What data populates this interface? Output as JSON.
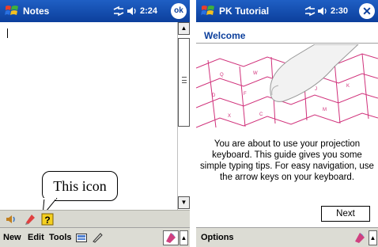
{
  "left": {
    "title": "Notes",
    "time": "2:24",
    "ok_label": "ok",
    "callout": "This icon",
    "menu": [
      "New",
      "Edit",
      "Tools"
    ]
  },
  "right": {
    "title": "PK Tutorial",
    "time": "2:30",
    "heading": "Welcome",
    "body_lines": [
      "You are about to use your projection",
      "keyboard. This guide gives you some",
      "simple typing tips. For easy navigation, use",
      "the arrow keys on your keyboard."
    ],
    "next_label": "Next",
    "menu": [
      "Options"
    ]
  },
  "icons": {
    "start": "windows-flag-icon",
    "signal": "signal-icon",
    "volume": "speaker-icon",
    "keyboard": "keyboard-icon",
    "pen": "pen-icon",
    "recorder": "recorder-icon",
    "help": "help-icon"
  },
  "colors": {
    "titlebar": "#0c3f9c",
    "welcome": "#0c3f9c",
    "keyboard_lines": "#d0307a"
  }
}
